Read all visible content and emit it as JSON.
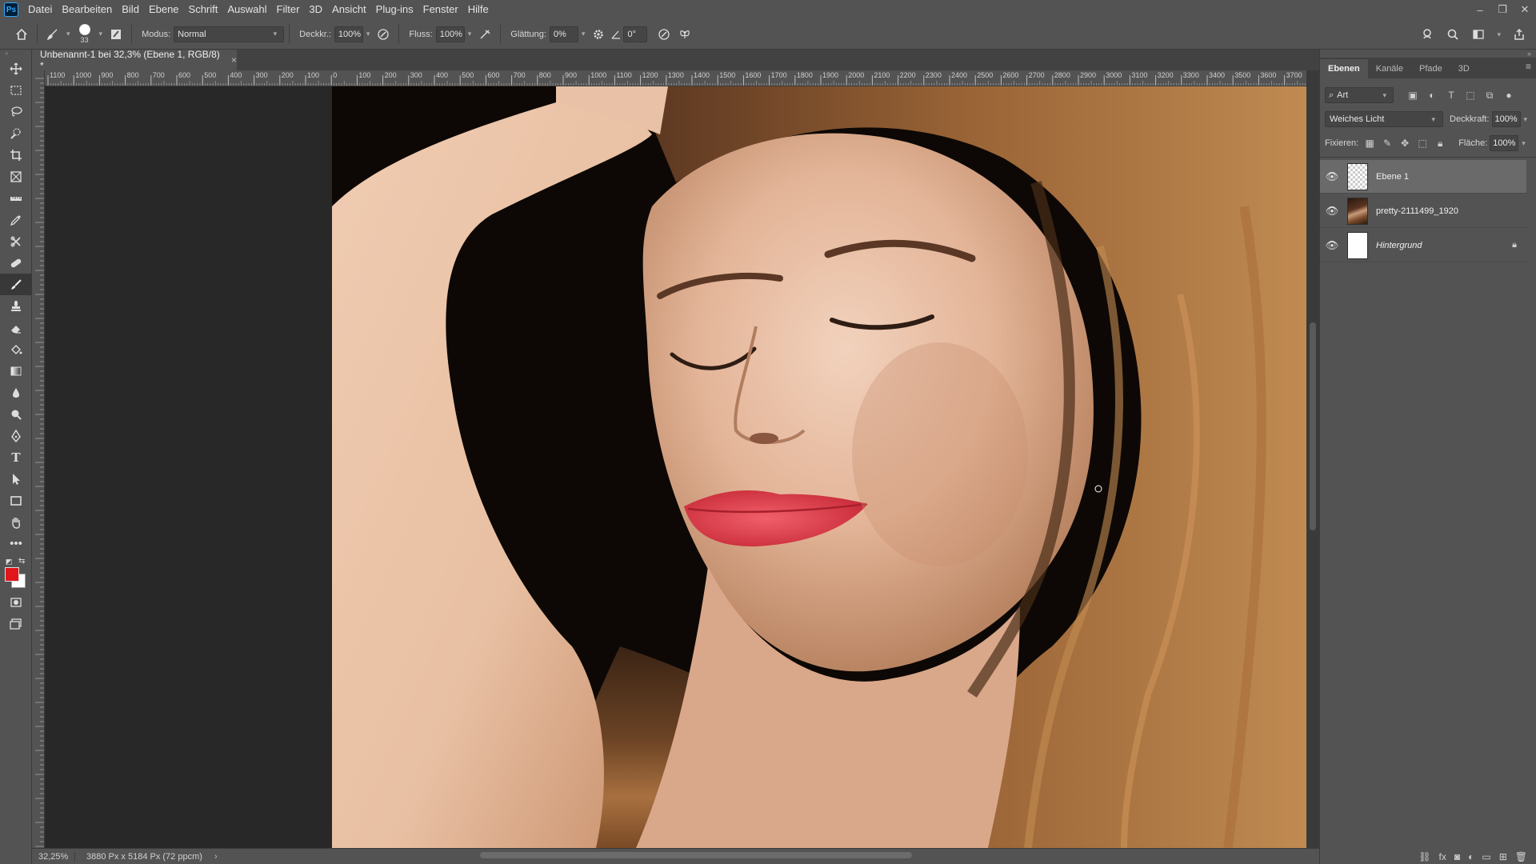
{
  "app": {
    "logo": "Ps"
  },
  "menu": [
    "Datei",
    "Bearbeiten",
    "Bild",
    "Ebene",
    "Schrift",
    "Auswahl",
    "Filter",
    "3D",
    "Ansicht",
    "Plug-ins",
    "Fenster",
    "Hilfe"
  ],
  "window_controls": {
    "minimize": "–",
    "restore": "❐",
    "close": "✕"
  },
  "options": {
    "brush_size": "33",
    "modus_label": "Modus:",
    "modus_value": "Normal",
    "deckkraft_label": "Deckkr.:",
    "deckkraft_value": "100%",
    "fluss_label": "Fluss:",
    "fluss_value": "100%",
    "glaettung_label": "Glättung:",
    "glaettung_value": "0%",
    "angle_value": "0°"
  },
  "document": {
    "tab_title": "Unbenannt-1 bei 32,3% (Ebene 1, RGB/8) *",
    "tab_close": "×"
  },
  "ruler": {
    "top_labels": [
      "1100",
      "1000",
      "900",
      "800",
      "700",
      "600",
      "500",
      "400",
      "300",
      "200",
      "100",
      "0",
      "100",
      "200",
      "300",
      "400",
      "500",
      "600",
      "700",
      "800",
      "900",
      "1000",
      "1100",
      "1200",
      "1300",
      "1400",
      "1500",
      "1600",
      "1700",
      "1800",
      "1900",
      "2000",
      "2100",
      "2200",
      "2300",
      "2400",
      "2500",
      "2600",
      "2700",
      "2800",
      "2900",
      "3000",
      "3100",
      "3200",
      "3300",
      "3400",
      "3500",
      "3600",
      "3700"
    ]
  },
  "status": {
    "zoom": "32,25%",
    "doc_info": "3880 Px x 5184 Px (72 ppcm)",
    "arrow": "›"
  },
  "panel": {
    "tabs": [
      "Ebenen",
      "Kanäle",
      "Pfade",
      "3D"
    ],
    "active_tab": 0,
    "filter_value": "Art",
    "blend_mode": "Weiches Licht",
    "opacity_label": "Deckkraft:",
    "opacity_value": "100%",
    "lock_label": "Fixieren:",
    "fill_label": "Fläche:",
    "fill_value": "100%",
    "layers": [
      {
        "name": "Ebene 1",
        "visible": true,
        "selected": true,
        "thumb": "transparent",
        "locked": false
      },
      {
        "name": "pretty-2111499_1920",
        "visible": true,
        "selected": false,
        "thumb": "photo",
        "locked": false
      },
      {
        "name": "Hintergrund",
        "visible": true,
        "selected": false,
        "thumb": "white",
        "locked": true
      }
    ]
  },
  "colors": {
    "foreground": "#e0161b",
    "background": "#ffffff",
    "ui_bg": "#535353",
    "canvas_bg": "#282828"
  }
}
